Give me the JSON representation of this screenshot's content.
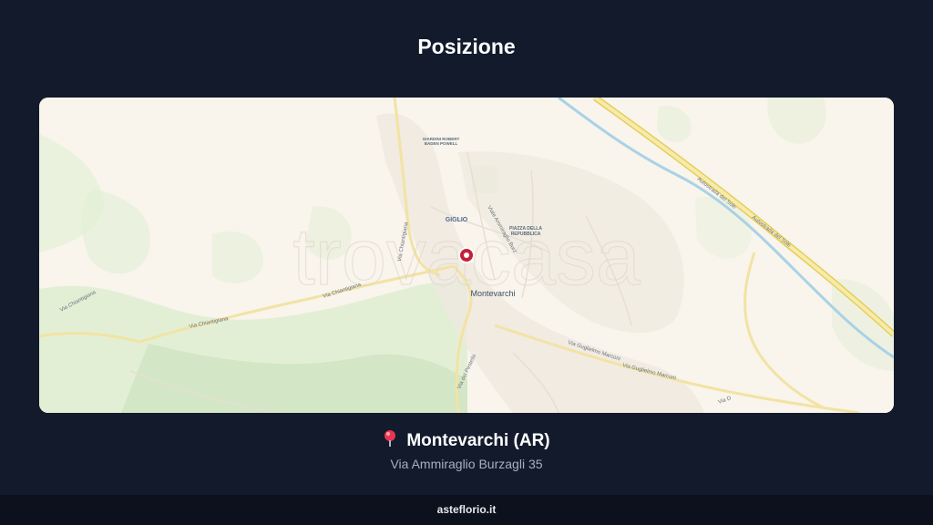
{
  "header": {
    "title": "Posizione"
  },
  "map": {
    "watermark": "trovacasa",
    "labels": {
      "city": "Montevarchi",
      "giglio": "GIGLIO",
      "piazza_line1": "PIAZZA DELLA",
      "piazza_line2": "REPUBBLICA",
      "giardini_line1": "GIARDINI ROBERT",
      "giardini_line2": "BADEN POWELL",
      "via_chiantigiana_1": "Via Chiantigiana",
      "via_chiantigiana_2": "Via Chiantigiana",
      "via_chiantigiana_3": "Via Chiantigiana",
      "via_chiantigiana_4": "Via Chiantigiana",
      "autostrada_1": "Autostrada del Sole",
      "autostrada_2": "Autostrada del Sole",
      "via_marconi_1": "Via Guglielmo Marconi",
      "via_marconi_2": "Via Guglielmo Marconi",
      "via_del_pestello": "Via del Pestello",
      "via_ammiraglio": "Viale Ammiraglio Burz",
      "via_d": "Via D"
    },
    "colors": {
      "background": "#f9f4ec",
      "green": "#d8e9cc",
      "road_major": "#f3e6a0",
      "river": "#a9d2e6",
      "marker": "#c4203a"
    }
  },
  "location": {
    "pin_icon": "round-pushpin",
    "name": "Montevarchi (AR)",
    "address": "Via Ammiraglio Burzagli 35"
  },
  "footer": {
    "site": "asteflorio.it"
  }
}
